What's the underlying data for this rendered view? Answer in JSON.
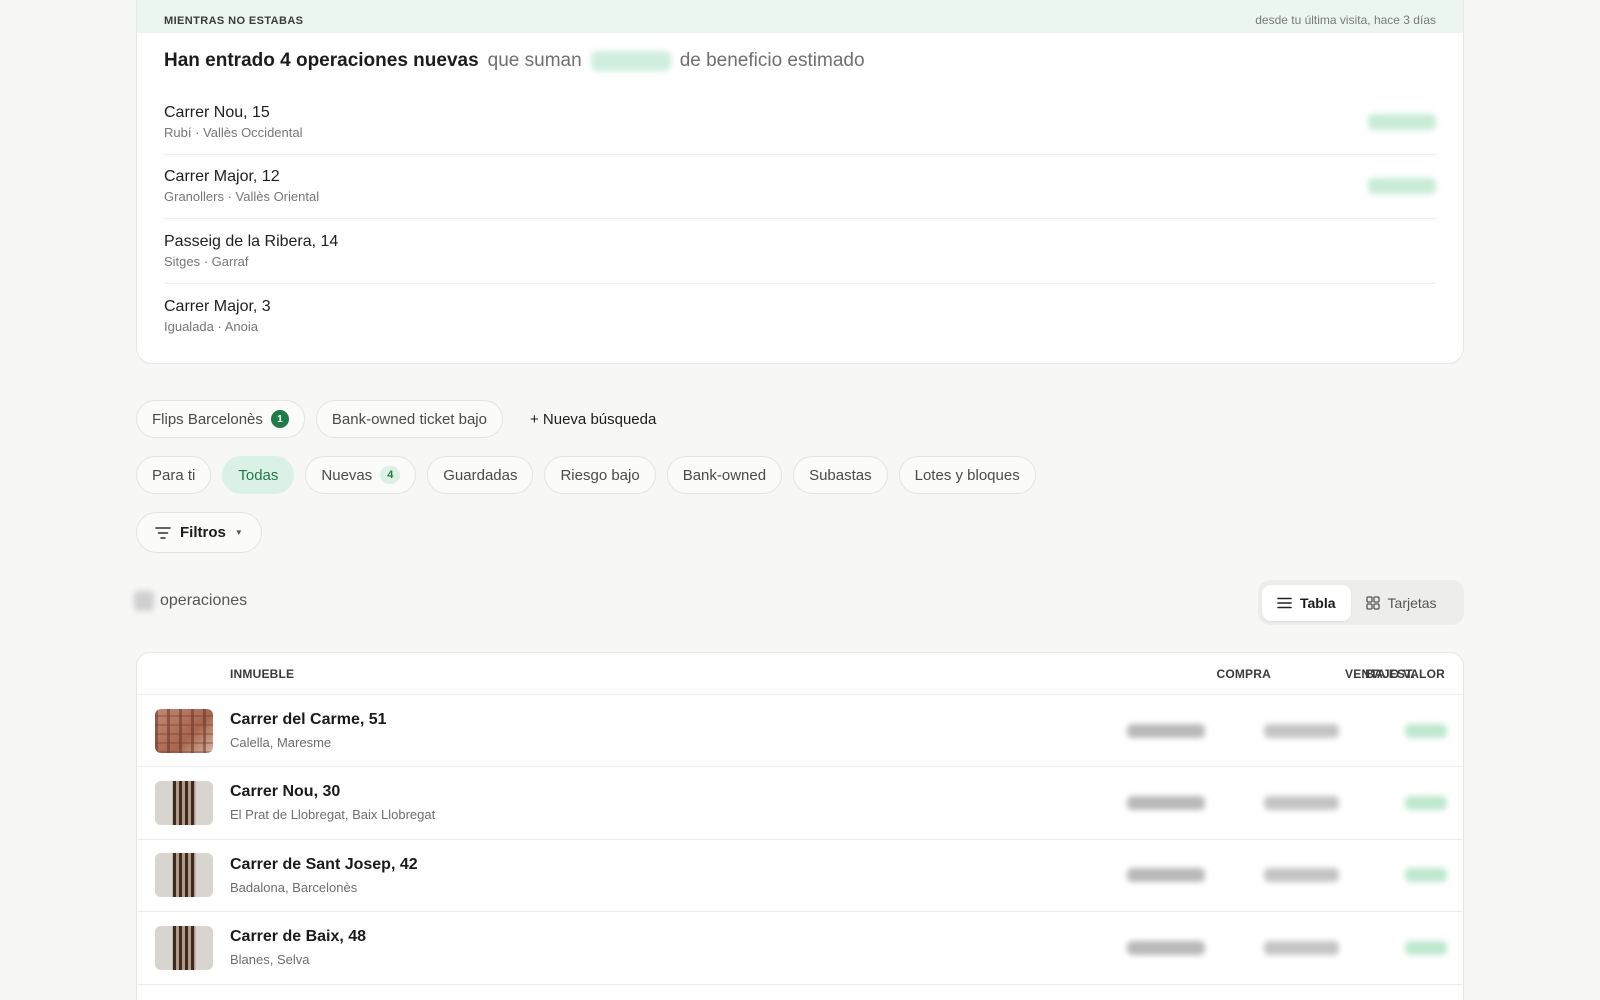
{
  "alert": {
    "eyebrow": "MIENTRAS NO ESTABAS",
    "since": "desde tu última visita, hace 3 días",
    "headline_strong": "Han entrado 4 operaciones nuevas",
    "headline_mid": "que suman",
    "headline_end": "de beneficio estimado",
    "operations": [
      {
        "title": "Carrer Nou, 15",
        "subtitle": "Rubí · Vallès Occidental"
      },
      {
        "title": "Carrer Major, 12",
        "subtitle": "Granollers · Vallès Oriental"
      },
      {
        "title": "Passeig de la Ribera, 14",
        "subtitle": "Sitges · Garraf"
      },
      {
        "title": "Carrer Major, 3",
        "subtitle": "Igualada · Anoia"
      }
    ]
  },
  "searches": {
    "items": [
      {
        "label": "Flips Barcelonès",
        "badge": "1"
      },
      {
        "label": "Bank-owned ticket bajo"
      }
    ],
    "new_search": "+ Nueva búsqueda"
  },
  "tabs": {
    "items": [
      {
        "label": "Para ti"
      },
      {
        "label": "Todas"
      },
      {
        "label": "Nuevas",
        "badge": "4"
      },
      {
        "label": "Guardadas"
      },
      {
        "label": "Riesgo bajo"
      },
      {
        "label": "Bank-owned"
      },
      {
        "label": "Subastas"
      },
      {
        "label": "Lotes y bloques"
      }
    ],
    "active": "Todas"
  },
  "filters": {
    "label": "Filtros",
    "caret_icon": "caret-down-icon"
  },
  "results": {
    "count_suffix": "operaciones"
  },
  "view_toggle": {
    "table_label": "Tabla",
    "cards_label": "Tarjetas",
    "active": "Tabla"
  },
  "table": {
    "headers": {
      "property": "INMUEBLE",
      "purchase": "COMPRA",
      "sale": "VENTA EST.",
      "undervalue": "BAJO VALOR"
    },
    "rows": [
      {
        "name": "Carrer del Carme, 51",
        "location": "Calella, Maresme",
        "thumb": "brick"
      },
      {
        "name": "Carrer Nou, 30",
        "location": "El Prat de Llobregat, Baix Llobregat",
        "thumb": "tower"
      },
      {
        "name": "Carrer de Sant Josep, 42",
        "location": "Badalona, Barcelonès",
        "thumb": "tower"
      },
      {
        "name": "Carrer de Baix, 48",
        "location": "Blanes, Selva",
        "thumb": "tower"
      }
    ]
  },
  "colors": {
    "accent": "#1f7a4a",
    "accent_bg": "#dcf1e5",
    "header_bg": "#eaf6ef",
    "page_bg": "#f7f7f6"
  }
}
